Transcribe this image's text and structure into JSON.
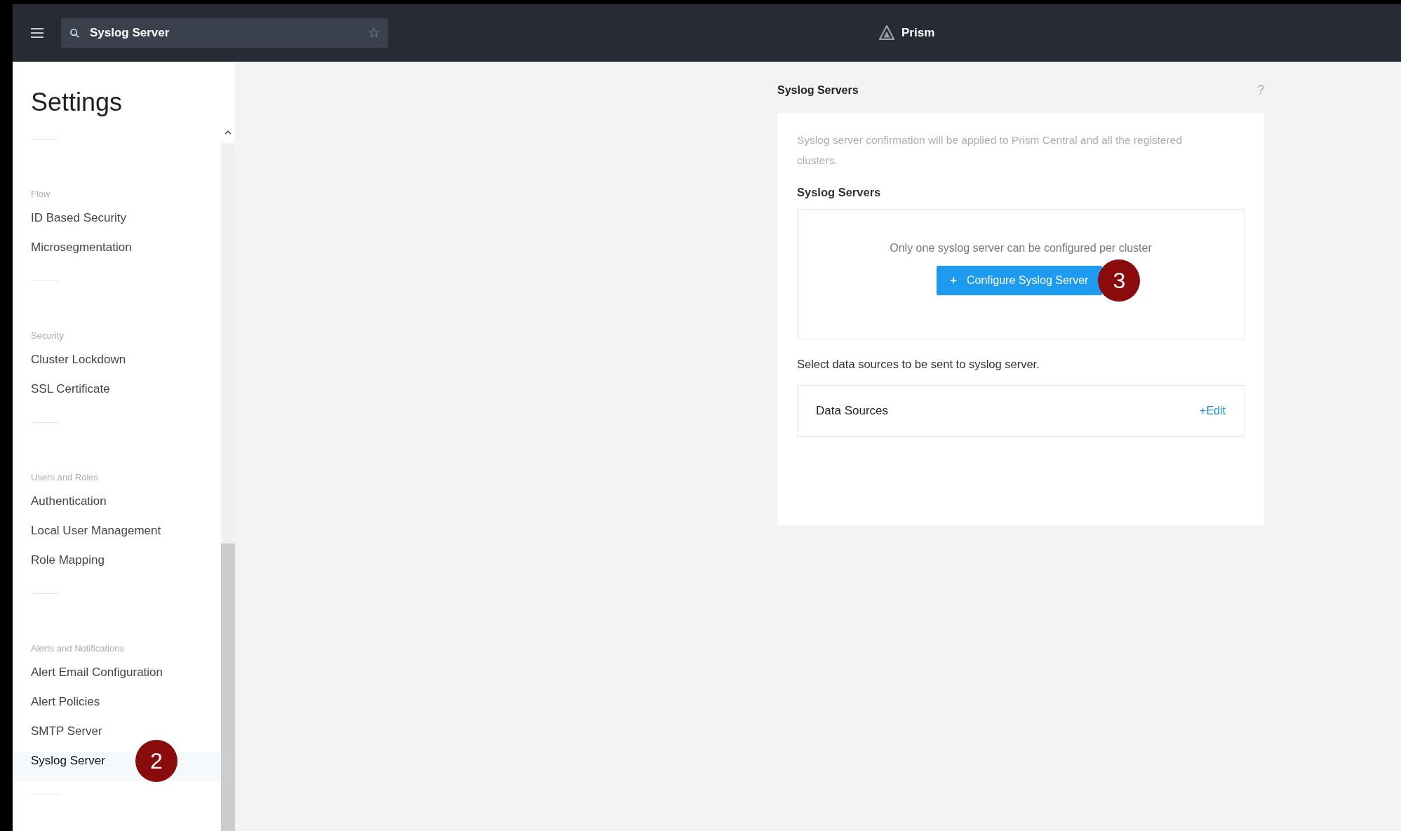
{
  "topbar": {
    "search": {
      "value": "Syslog Server"
    },
    "app_name": "Prism"
  },
  "sidebar": {
    "title": "Settings",
    "sections": [
      {
        "header": "Flow",
        "items": [
          {
            "label": "ID Based Security",
            "selected": false
          },
          {
            "label": "Microsegmentation",
            "selected": false
          }
        ]
      },
      {
        "header": "Security",
        "items": [
          {
            "label": "Cluster Lockdown",
            "selected": false
          },
          {
            "label": "SSL Certificate",
            "selected": false
          }
        ]
      },
      {
        "header": "Users and Roles",
        "items": [
          {
            "label": "Authentication",
            "selected": false
          },
          {
            "label": "Local User Management",
            "selected": false
          },
          {
            "label": "Role Mapping",
            "selected": false
          }
        ]
      },
      {
        "header": "Alerts and Notifications",
        "items": [
          {
            "label": "Alert Email Configuration",
            "selected": false
          },
          {
            "label": "Alert Policies",
            "selected": false
          },
          {
            "label": "SMTP Server",
            "selected": false
          },
          {
            "label": "Syslog Server",
            "selected": true,
            "step": "2"
          }
        ]
      }
    ]
  },
  "panel": {
    "title": "Syslog Servers",
    "help": "?",
    "description": "Syslog server confirmation will be applied to Prism Central and all the registered clusters.",
    "servers_heading": "Syslog Servers",
    "servers_note": "Only one syslog server can be configured per cluster",
    "configure_button": {
      "icon": "+",
      "label": "Configure Syslog Server",
      "step": "3"
    },
    "sources_note": "Select data sources to be sent to syslog server.",
    "sources_label": "Data Sources",
    "edit_link": "+Edit"
  }
}
